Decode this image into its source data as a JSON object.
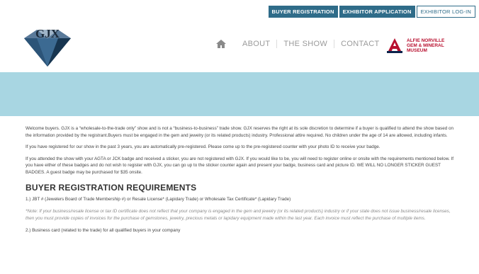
{
  "topbar": {
    "buyer_registration": "BUYER REGISTRATION",
    "exhibitor_application": "EXHIBITOR APPLICATION",
    "exhibitor_login": "EXHIBITOR LOG-IN"
  },
  "logo": {
    "text": "GJX"
  },
  "nav": {
    "home_icon": "home-icon",
    "about": "ABOUT",
    "the_show": "THE SHOW",
    "contact": "CONTACT"
  },
  "sponsor": {
    "line1": "ALFIE NORVILLE",
    "line2": "GEM & MINERAL",
    "line3": "MUSEUM"
  },
  "content": {
    "para1": "Welcome buyers. GJX is a “wholesale-to-the-trade only” show and is not a “business-to-business” trade show. GJX reserves the right at its sole discretion to determine if a buyer is qualified to attend the show based on the information provided by the registrant.Buyers must be engaged in the gem and jewelry (or its related products) industry. Professional attire required. No children under the age of 14 are allowed, including infants.",
    "para2": "If you have registered for our show in the past 3 years, you are automatically pre-registered. Please come up to the pre-registered counter with your photo ID to receive your badge.",
    "para3": "If you attended the show with your AGTA or JCK badge and received a sticker, you are not registered with GJX. If you would like to be, you will need to register online or onsite with the requirements mentioned below. If you have either of these badges and do not wish to register with GJX, you can go up to the sticker counter again and present your badge, business card and picture ID. WE WILL NO LONGER STICKER GUEST BADGES. A guest badge may be purchased for $35 onsite.",
    "heading": "BUYER REGISTRATION REQUIREMENTS",
    "req1": "1.) JBT # (Jewelers Board of Trade Membership #) or Resale License* (Lapidary Trade) or Wholesale Tax Certificate* (Lapidary Trade)",
    "note": "*Note: If your business/resale license or tax ID certificate does not reflect that your company is engaged in the gem and jewelry (or its related products) industry or if your state does not issue business/resale licenses, then you must provide copies of invoices for the purchase of gemstones, jewelry, precious metals or lapidary equipment made within the last year. Each invoice must reflect the purchase of multiple items.",
    "req2": "2.) Business card (related to the trade) for all qualified buyers in your company"
  },
  "colors": {
    "topbar_button": "#2f6c89",
    "banner": "#a8d6e2",
    "sponsor_red": "#b8102f"
  }
}
